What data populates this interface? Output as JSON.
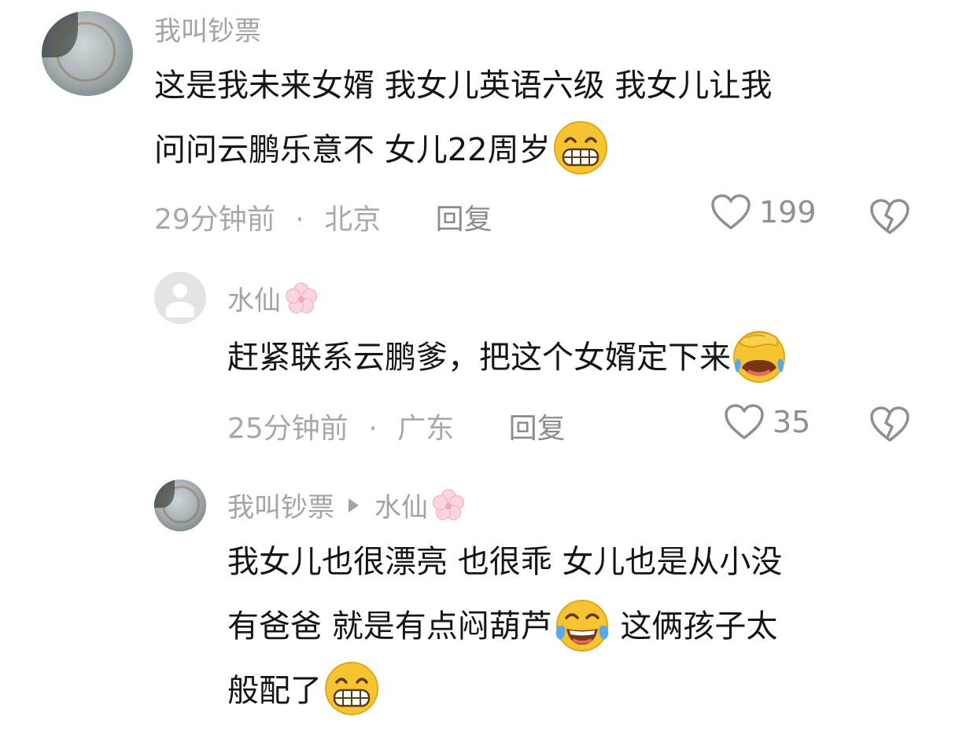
{
  "comments": [
    {
      "username": "我叫钞票",
      "text_lines": [
        "这是我未来女婿 我女儿英语六级 我女儿让我",
        "问问云鹏乐意不 女儿22周岁"
      ],
      "emoji": "grin-emoji",
      "time": "29分钟前",
      "location": "北京",
      "reply_label": "回复",
      "likes": "199"
    },
    {
      "username": "水仙",
      "badge": "cherry-blossom-icon",
      "text": "赶紧联系云鹏爹，把这个女婿定下来",
      "emoji": "facepalm-laugh-emoji",
      "time": "25分钟前",
      "location": "广东",
      "reply_label": "回复",
      "likes": "35"
    },
    {
      "username": "我叫钞票",
      "reply_to": "水仙",
      "badge": "cherry-blossom-icon",
      "text_line1": "我女儿也很漂亮 也很乖 女儿也是从小没",
      "text_line2a": "有爸爸 就是有点闷葫芦",
      "text_line2b": " 这俩孩子太",
      "text_line3": "般配了",
      "emojis": [
        "tears-of-joy-emoji",
        "grin-emoji"
      ]
    }
  ],
  "meta_separator": "·",
  "colors": {
    "meta_gray": "#a8a8a8",
    "text": "#151515",
    "emoji_yellow": "#f7c431"
  }
}
